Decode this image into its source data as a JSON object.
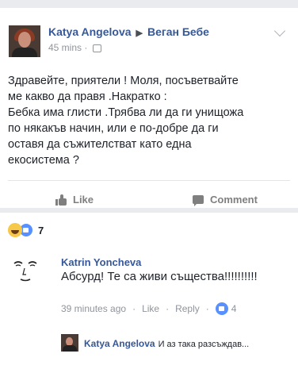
{
  "post": {
    "author": "Katya Angelova",
    "group": "Веган Бебе",
    "time": "45 mins",
    "text": "Здравейте, приятели ! Моля, посъветвайте\nме какво да правя .Накратко :\nБебка има глисти .Трябва ли да ги унищожа\nпо някакъв начин, или е по-добре да ги\nоставя да съжителстват като една\nекосистема ?",
    "actions": {
      "like": "Like",
      "comment": "Comment"
    }
  },
  "reactions": {
    "count": "7"
  },
  "comment": {
    "author": "Katrin Yoncheva",
    "text": "Абсурд! Те са живи същества!!!!!!!!!!",
    "time": "39 minutes ago",
    "like": "Like",
    "reply": "Reply",
    "likes": "4"
  },
  "reply": {
    "author": "Katya Angelova",
    "text": "И аз така разсъждав..."
  }
}
